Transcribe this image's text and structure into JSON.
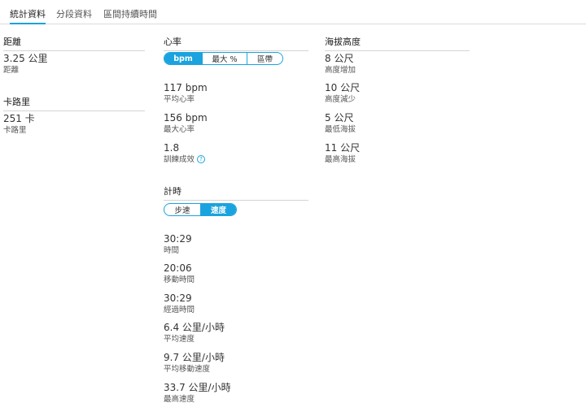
{
  "tabs": [
    {
      "label": "統計資料",
      "active": true
    },
    {
      "label": "分段資料",
      "active": false
    },
    {
      "label": "區間持續時間",
      "active": false
    }
  ],
  "distance": {
    "title": "距離",
    "value": "3.25 公里",
    "label": "距離"
  },
  "calories": {
    "title": "卡路里",
    "value": "251 卡",
    "label": "卡路里"
  },
  "heart_rate": {
    "title": "心率",
    "toggle": [
      "bpm",
      "最大 %",
      "區帶"
    ],
    "selected": "bpm",
    "stats": [
      {
        "value": "117 bpm",
        "label": "平均心率"
      },
      {
        "value": "156 bpm",
        "label": "最大心率"
      },
      {
        "value": "1.8",
        "label": "訓練成效"
      }
    ],
    "help_icon": "question-circle-icon"
  },
  "timing": {
    "title": "計時",
    "toggle": [
      "步速",
      "速度"
    ],
    "selected": "速度",
    "stats": [
      {
        "value": "30:29",
        "label": "時間"
      },
      {
        "value": "20:06",
        "label": "移動時間"
      },
      {
        "value": "30:29",
        "label": "經過時間"
      },
      {
        "value": "6.4 公里/小時",
        "label": "平均速度"
      },
      {
        "value": "9.7 公里/小時",
        "label": "平均移動速度"
      },
      {
        "value": "33.7 公里/小時",
        "label": "最高速度"
      }
    ]
  },
  "elevation": {
    "title": "海拔高度",
    "stats": [
      {
        "value": "8 公尺",
        "label": "高度增加"
      },
      {
        "value": "10 公尺",
        "label": "高度減少"
      },
      {
        "value": "5 公尺",
        "label": "最低海拔"
      },
      {
        "value": "11 公尺",
        "label": "最高海拔"
      }
    ]
  },
  "colors": {
    "accent": "#1aa3de",
    "text": "#333333",
    "divider": "#d4d4d4"
  }
}
